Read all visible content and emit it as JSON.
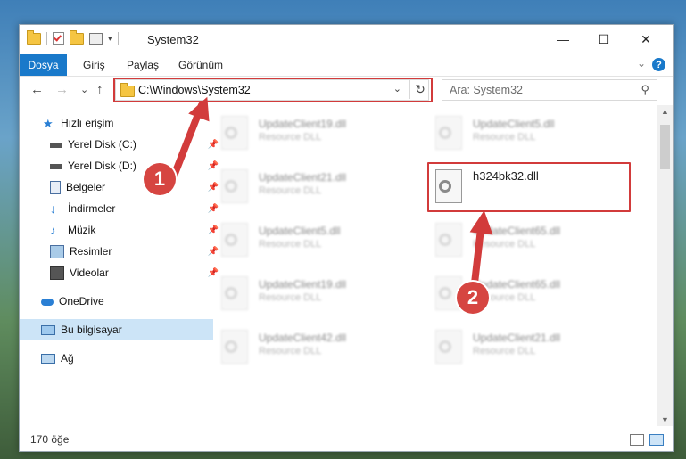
{
  "window": {
    "title": "System32"
  },
  "titlebar": {
    "minimize": "—",
    "maximize": "☐",
    "close": "✕"
  },
  "ribbon": {
    "file_tab": "Dosya",
    "tabs": [
      "Giriş",
      "Paylaş",
      "Görünüm"
    ],
    "expand": "⌄",
    "help": "?"
  },
  "nav": {
    "back": "←",
    "forward": "→",
    "recent": "⌄",
    "up": "↑",
    "address": "C:\\Windows\\System32",
    "address_dropdown": "⌄",
    "refresh": "↻",
    "search_placeholder": "Ara: System32",
    "search_icon": "⚲"
  },
  "navpane": {
    "items": [
      {
        "label": "Hızlı erişim",
        "icon": "star-icon"
      },
      {
        "label": "Yerel Disk (C:)",
        "icon": "drive-icon",
        "pinned": true
      },
      {
        "label": "Yerel Disk (D:)",
        "icon": "drive-icon",
        "pinned": true
      },
      {
        "label": "Belgeler",
        "icon": "documents-icon",
        "pinned": true
      },
      {
        "label": "İndirmeler",
        "icon": "download-icon",
        "pinned": true
      },
      {
        "label": "Müzik",
        "icon": "music-icon",
        "pinned": true
      },
      {
        "label": "Resimler",
        "icon": "pictures-icon",
        "pinned": true
      },
      {
        "label": "Videolar",
        "icon": "videos-icon",
        "pinned": true
      },
      {
        "label": "OneDrive",
        "icon": "cloud-icon"
      },
      {
        "label": "Bu bilgisayar",
        "icon": "computer-icon",
        "selected": true
      },
      {
        "label": "Ağ",
        "icon": "network-icon"
      }
    ],
    "pin_glyph": "📌"
  },
  "files": {
    "left": [
      {
        "name": "UpdateClient19.dll",
        "type": "Resource DLL"
      },
      {
        "name": "UpdateClient21.dll",
        "type": "Resource DLL"
      },
      {
        "name": "UpdateClient5.dll",
        "type": "Resource DLL"
      },
      {
        "name": "UpdateClient19.dll",
        "type": "Resource DLL"
      },
      {
        "name": "UpdateClient42.dll",
        "type": "Resource DLL"
      }
    ],
    "right": [
      {
        "name": "UpdateClient5.dll",
        "type": "Resource DLL"
      },
      {
        "name": "h324bk32.dll",
        "type": ""
      },
      {
        "name": "UpdateClient65.dll",
        "type": "Resource DLL"
      },
      {
        "name": "UpdateClient65.dll",
        "type": "Resource DLL"
      },
      {
        "name": "UpdateClient21.dll",
        "type": "Resource DLL"
      }
    ]
  },
  "status": {
    "count": "170 öğe"
  },
  "annotations": {
    "step1": "1",
    "step2": "2",
    "color": "#d23b3b"
  }
}
